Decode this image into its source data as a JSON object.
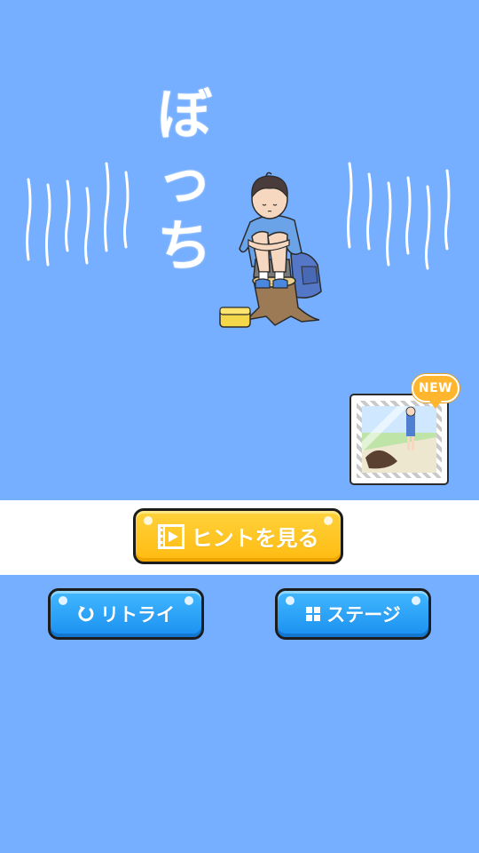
{
  "stage": {
    "title_chars": [
      "ぼ",
      "っ",
      "ち"
    ]
  },
  "new_card": {
    "badge": "NEW"
  },
  "buttons": {
    "hint": {
      "label": "ヒントを見る",
      "icon": "video-play-icon"
    },
    "retry": {
      "label": "リトライ",
      "icon": "retry-arrow-icon"
    },
    "stage": {
      "label": "ステージ",
      "icon": "grid-icon"
    }
  },
  "colors": {
    "background": "#76afff",
    "hint_button": "#ffc21f",
    "blue_button": "#2ea4f8",
    "band": "#ffffff"
  }
}
